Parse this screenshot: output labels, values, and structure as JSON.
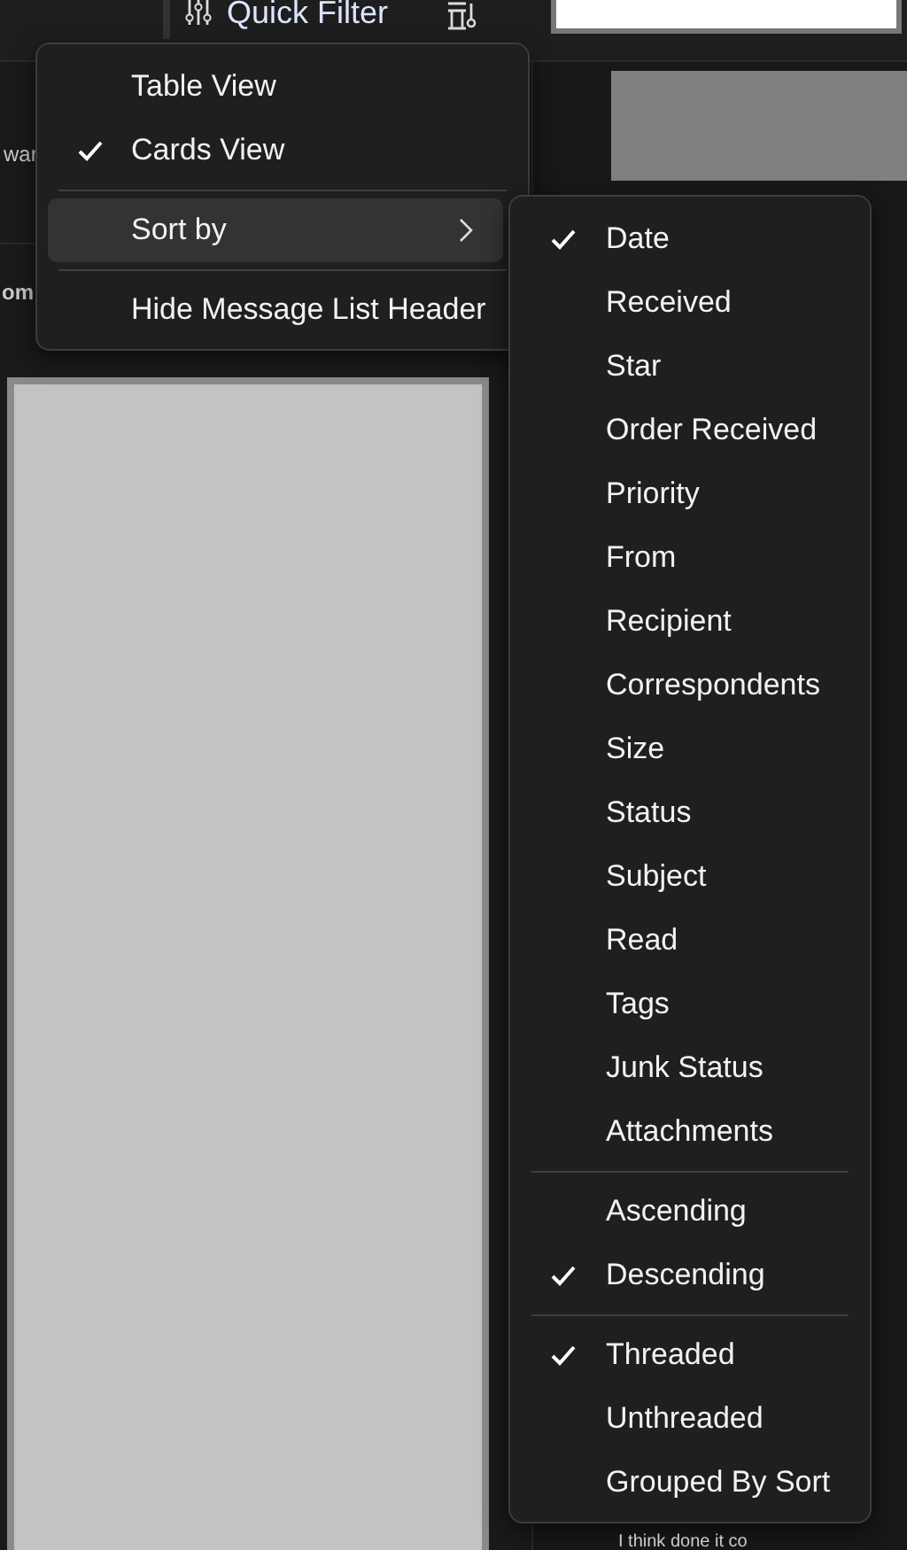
{
  "toolbar": {
    "quick_filter": {
      "label": "Quick Filter"
    }
  },
  "background_texts": [
    {
      "text": "war",
      "bold": false
    },
    {
      "text": "om",
      "bold": true
    }
  ],
  "preview_text": "I think done it co",
  "context_menu": {
    "items": [
      {
        "kind": "item",
        "label": "Table View",
        "checked": false
      },
      {
        "kind": "item",
        "label": "Cards View",
        "checked": true
      },
      {
        "kind": "separator"
      },
      {
        "kind": "submenu",
        "label": "Sort by",
        "selected": true
      },
      {
        "kind": "separator"
      },
      {
        "kind": "item",
        "label": "Hide Message List Header",
        "checked": false
      }
    ]
  },
  "sort_menu": {
    "items": [
      {
        "kind": "item",
        "label": "Date",
        "checked": true
      },
      {
        "kind": "item",
        "label": "Received",
        "checked": false
      },
      {
        "kind": "item",
        "label": "Star",
        "checked": false
      },
      {
        "kind": "item",
        "label": "Order Received",
        "checked": false
      },
      {
        "kind": "item",
        "label": "Priority",
        "checked": false
      },
      {
        "kind": "item",
        "label": "From",
        "checked": false
      },
      {
        "kind": "item",
        "label": "Recipient",
        "checked": false
      },
      {
        "kind": "item",
        "label": "Correspondents",
        "checked": false
      },
      {
        "kind": "item",
        "label": "Size",
        "checked": false
      },
      {
        "kind": "item",
        "label": "Status",
        "checked": false
      },
      {
        "kind": "item",
        "label": "Subject",
        "checked": false
      },
      {
        "kind": "item",
        "label": "Read",
        "checked": false
      },
      {
        "kind": "item",
        "label": "Tags",
        "checked": false
      },
      {
        "kind": "item",
        "label": "Junk Status",
        "checked": false
      },
      {
        "kind": "item",
        "label": "Attachments",
        "checked": false
      },
      {
        "kind": "separator"
      },
      {
        "kind": "item",
        "label": "Ascending",
        "checked": false
      },
      {
        "kind": "item",
        "label": "Descending",
        "checked": true
      },
      {
        "kind": "separator"
      },
      {
        "kind": "item",
        "label": "Threaded",
        "checked": true
      },
      {
        "kind": "item",
        "label": "Unthreaded",
        "checked": false
      },
      {
        "kind": "item",
        "label": "Grouped By Sort",
        "checked": false
      }
    ]
  }
}
